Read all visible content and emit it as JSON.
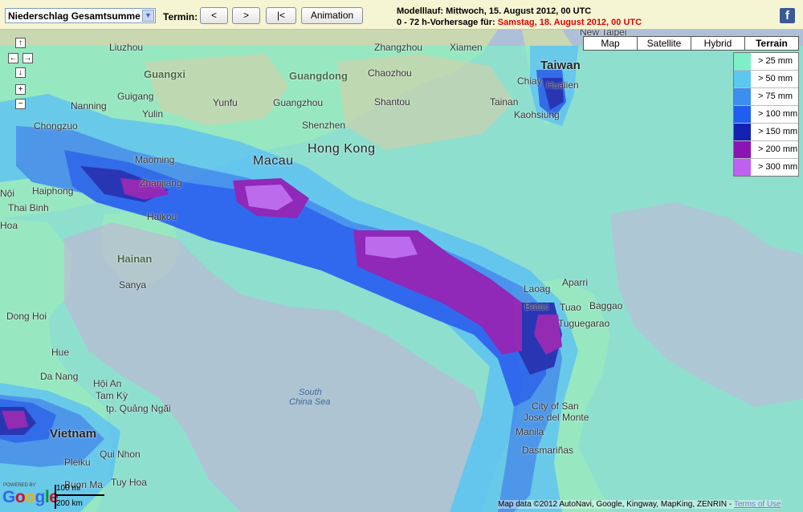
{
  "toolbar": {
    "product_select": "Niederschlag Gesamtsumme",
    "termin_label": "Termin:",
    "prev_label": "<",
    "next_label": ">",
    "first_label": "|<",
    "animation_label": "Animation",
    "model_run": "Modelllauf: Mittwoch, 15. August 2012, 00 UTC",
    "forecast_prefix": "0 - 72 h-Vorhersage für:",
    "forecast_date": "Samstag, 18. August 2012, 00 UTC",
    "facebook_icon": "f"
  },
  "map_types": [
    {
      "label": "Map",
      "active": false
    },
    {
      "label": "Satellite",
      "active": false
    },
    {
      "label": "Hybrid",
      "active": false
    },
    {
      "label": "Terrain",
      "active": true
    }
  ],
  "legend": [
    {
      "label": "> 25 mm",
      "color": "#7ef0c8"
    },
    {
      "label": "> 50 mm",
      "color": "#5cc8f0"
    },
    {
      "label": "> 75 mm",
      "color": "#3c8ef0"
    },
    {
      "label": "> 100 mm",
      "color": "#1f5ef0"
    },
    {
      "label": "> 150 mm",
      "color": "#1420b4"
    },
    {
      "label": "> 200 mm",
      "color": "#8c14b4"
    },
    {
      "label": "> 300 mm",
      "color": "#c060f0"
    }
  ],
  "places": {
    "liuzhou": "Liuzhou",
    "guangxi": "Guangxi",
    "guigang": "Guigang",
    "yulin": "Yulin",
    "nanning": "Nanning",
    "chongzuo": "Chongzuo",
    "maoming": "Maoming",
    "zhanjiang": "Zhanjiang",
    "macau": "Macau",
    "hongkong": "Hong Kong",
    "shenzhen": "Shenzhen",
    "guangzhou": "Guangzhou",
    "guangdong": "Guangdong",
    "yunfu": "Yunfu",
    "zhangzhou": "Zhangzhou",
    "xiamen": "Xiamen",
    "chaozhou": "Chaozhou",
    "shantou": "Shantou",
    "taiwan": "Taiwan",
    "newtaipei": "New Taipei",
    "chiayi": "Chiay",
    "hualien": "Hualien",
    "tainan": "Tainan",
    "kaohsiung": "Kaohsiung",
    "haiphong": "Haiphong",
    "noi": "Nội",
    "thaibinh": "Thai Binh",
    "hoa": "Hoa",
    "haikou": "Haikou",
    "hainan": "Hainan",
    "sanya": "Sanya",
    "donghoi": "Dong Hoi",
    "hue": "Hue",
    "danang": "Da Nang",
    "hoian": "Hội An",
    "tamky": "Tam Kỳ",
    "quangngai": "tp. Quảng Ngãi",
    "vietnam": "Vietnam",
    "quinhon": "Qui Nhon",
    "pleiku": "Pleiku",
    "buonma": "Buon Ma",
    "tuyhoa": "Tuy Hoa",
    "south": "South",
    "chinasea": "China Sea",
    "laoag": "Laoag",
    "aparri": "Aparri",
    "batac": "Batac",
    "tuao": "Tuao",
    "baggao": "Baggao",
    "tuguegarao": "Tuguegarao",
    "cityofsan": "City of San",
    "josedelmonte": "Jose del Monte",
    "manila": "Manila",
    "dasmarinas": "Dasmariñas"
  },
  "scale": {
    "mi": "100 mi",
    "km": "200 km"
  },
  "google": {
    "powered_by": "POWERED BY",
    "logo": "Google"
  },
  "attribution": {
    "text": "Map data ©2012 AutoNavi, Google, Kingway, MapKing, ZENRIN -",
    "terms": "Terms of Use"
  }
}
